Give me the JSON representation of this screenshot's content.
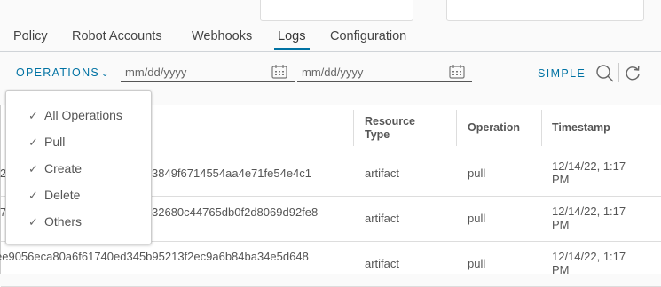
{
  "tabs": [
    "Policy",
    "Robot Accounts",
    "Webhooks",
    "Logs",
    "Configuration"
  ],
  "filter": {
    "operations_label": "OPERATIONS",
    "start_date_placeholder": "mm/dd/yyyy",
    "end_date_placeholder": "mm/dd/yyyy",
    "simple_label": "SIMPLE"
  },
  "table": {
    "headers": [
      "Resource Type",
      "Operation",
      "Timestamp"
    ],
    "rows": [
      {
        "id_fragment": "3849f6714554aa4e71fe54e4c1",
        "left_fragment": "2:",
        "resource_type": "artifact",
        "operation": "pull",
        "timestamp": "12/14/22, 1:17 PM"
      },
      {
        "id_fragment": "32680c44765db0f2d8069d92fe8",
        "left_fragment": "7",
        "resource_type": "artifact",
        "operation": "pull",
        "timestamp": "12/14/22, 1:17 PM"
      },
      {
        "id_fragment": "ee9056eca80a6f61740ed345b95213f2ec9a6b84ba34e5d648",
        "left_fragment": "",
        "resource_type": "artifact",
        "operation": "pull",
        "timestamp": "12/14/22, 1:17 PM"
      }
    ]
  },
  "dropdown": {
    "items": [
      "All Operations",
      "Pull",
      "Create",
      "Delete",
      "Others"
    ]
  }
}
